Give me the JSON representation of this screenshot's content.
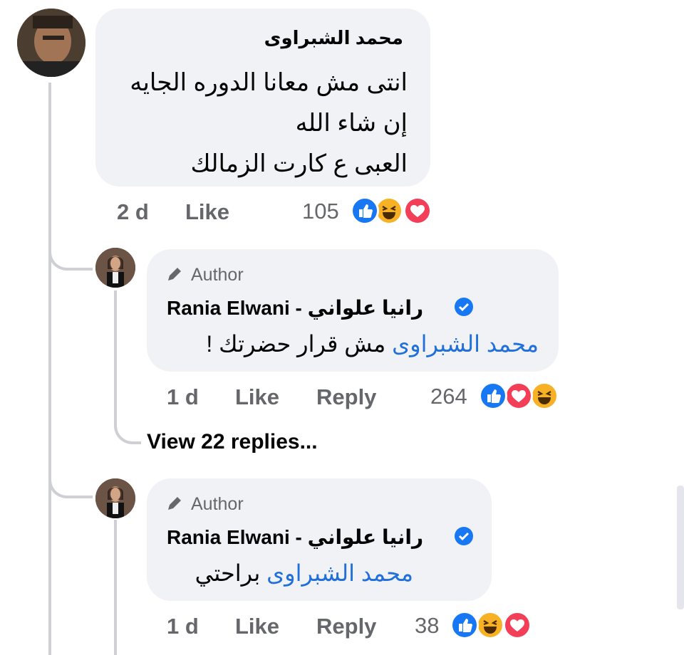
{
  "colors": {
    "mention": "#216fdb",
    "bubble": "#f0f2f5",
    "meta": "#65676b",
    "like_blue": "#1877f2",
    "love_red": "#f33e58",
    "haha_yellow": "#f7b125"
  },
  "comment": {
    "author": "محمد الشبراوى",
    "lines": [
      "انتى مش معانا الدوره الجايه",
      "إن شاء الله",
      "العبى ع كارت الزمالك"
    ],
    "time": "2 d",
    "like_label": "Like",
    "reaction_count": "105",
    "reactions": [
      "like-icon",
      "haha-icon",
      "love-icon"
    ]
  },
  "reply1": {
    "badge_icon": "pencil-icon",
    "badge": "Author",
    "name": "Rania Elwani - رانيا علواني",
    "mention": "محمد الشبراوى",
    "text": "مش قرار حضرتك !",
    "time": "1 d",
    "like_label": "Like",
    "reply_label": "Reply",
    "reaction_count": "264",
    "reactions": [
      "like-icon",
      "love-icon",
      "haha-icon"
    ]
  },
  "view_replies": "View 22 replies...",
  "reply2": {
    "badge_icon": "pencil-icon",
    "badge": "Author",
    "name": "Rania Elwani - رانيا علواني",
    "mention": "محمد الشبراوى",
    "text": "براحتي",
    "time": "1 d",
    "like_label": "Like",
    "reply_label": "Reply",
    "reaction_count": "38",
    "reactions": [
      "like-icon",
      "haha-icon",
      "love-icon"
    ]
  }
}
